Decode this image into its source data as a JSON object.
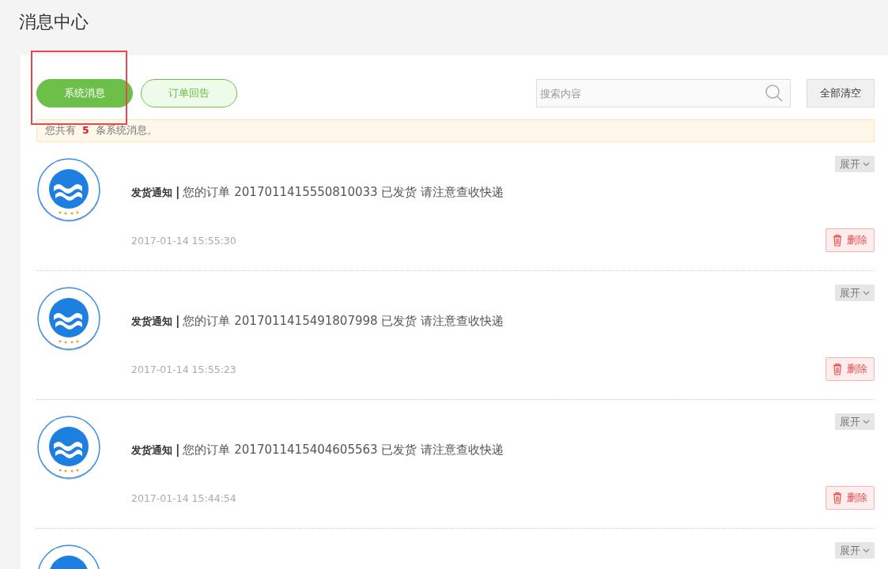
{
  "page_title": "消息中心",
  "tabs": [
    {
      "label": "系统消息",
      "selected": true,
      "highlighted": true
    },
    {
      "label": "订单回告",
      "selected": false,
      "highlighted": false
    }
  ],
  "search": {
    "placeholder": "搜索内容"
  },
  "clear_all_button": "全部清空",
  "notice": "您共有 **5** 条系统消息。",
  "messages": [
    {
      "expand_label": "展开",
      "title": "发货通知",
      "separator": "|",
      "body": "您的订单 2017011415550810033 已发货 请注意查收快递",
      "time": "2017-01-14 15:55:30",
      "delete_label": "删除"
    },
    {
      "expand_label": "展开",
      "title": "发货通知",
      "separator": "|",
      "body": "您的订单 2017011415491807998 已发货 请注意查收快递",
      "time": "2017-01-14 15:55:23",
      "delete_label": "删除"
    },
    {
      "expand_label": "展开",
      "title": "发货通知",
      "separator": "|",
      "body": "您的订单 2017011415404605563 已发货 请注意查收快递",
      "time": "2017-01-14 15:44:54",
      "delete_label": "删除"
    },
    {
      "expand_label": "展开"
    }
  ]
}
